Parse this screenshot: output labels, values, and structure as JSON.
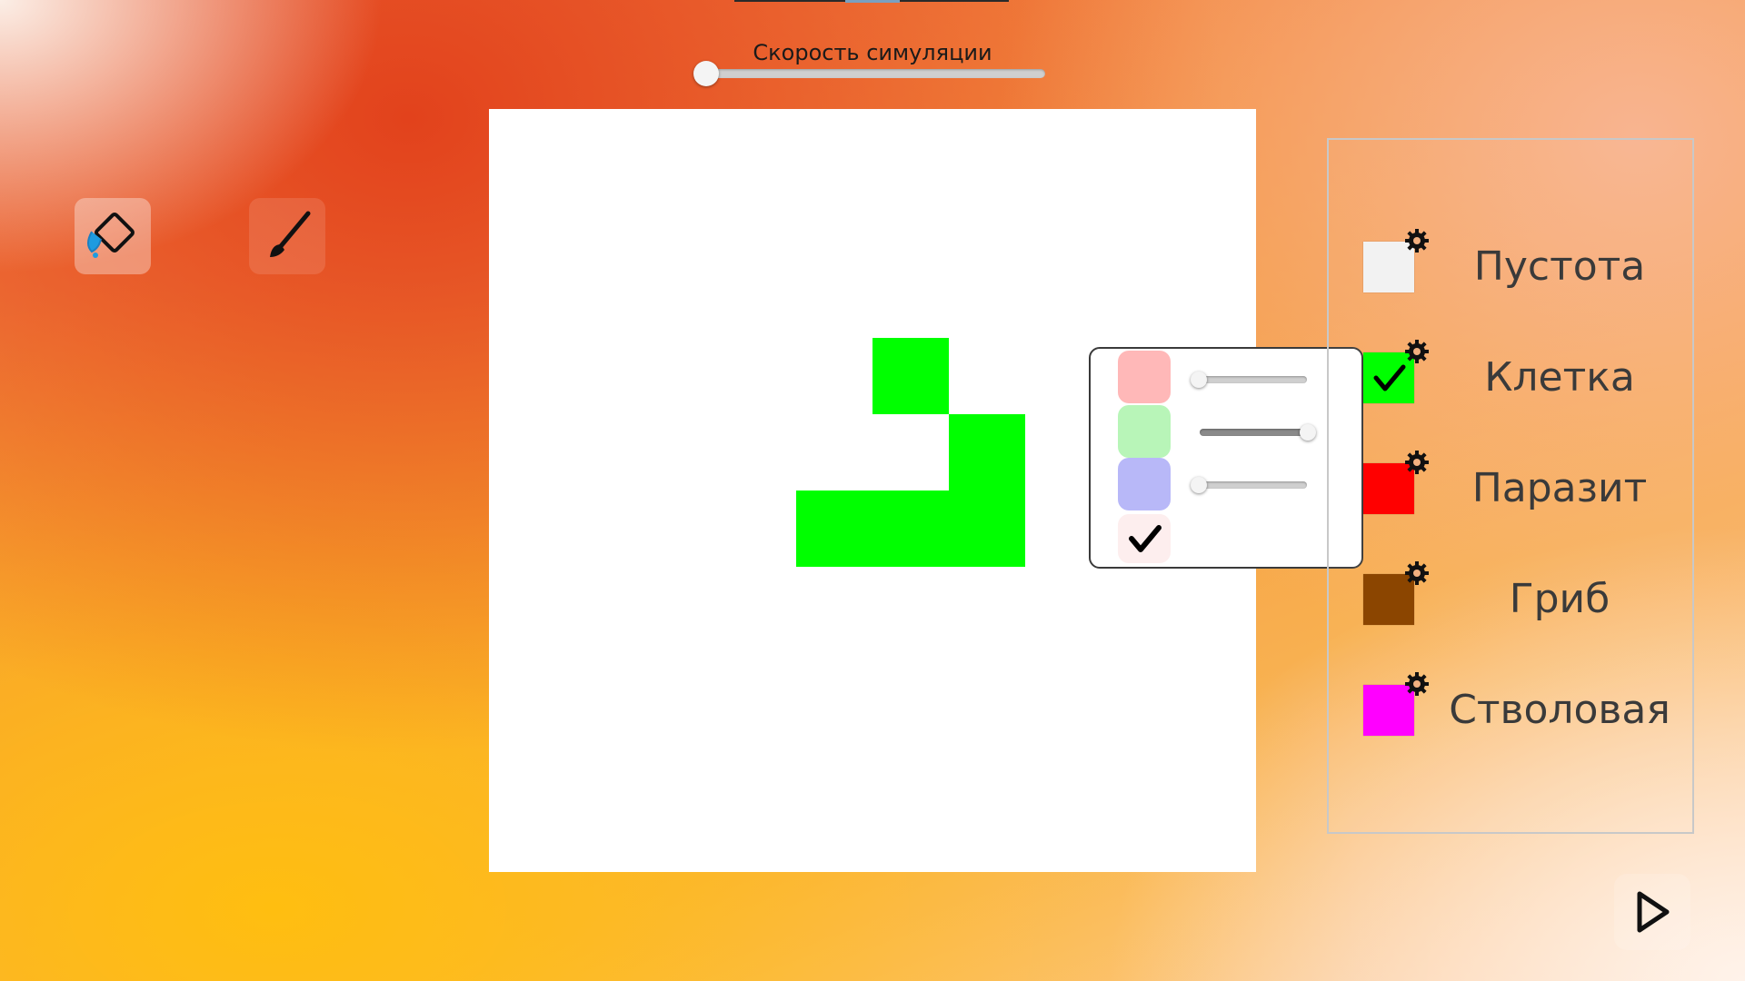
{
  "speed": {
    "label": "Скорость симуляции",
    "value": 0
  },
  "tools": [
    {
      "name": "fill-bucket",
      "active": true
    },
    {
      "name": "brush",
      "active": false
    }
  ],
  "grid": {
    "cell_color": "#00ff00",
    "background": "#ffffff"
  },
  "color_editor": {
    "channels": [
      {
        "channel": "red",
        "swatch_color": "#ffb8b8",
        "value": 0
      },
      {
        "channel": "green",
        "swatch_color": "#b8f5b8",
        "value": 1
      },
      {
        "channel": "blue",
        "swatch_color": "#b8b8f8",
        "value": 0
      }
    ],
    "confirm_icon": "check-icon"
  },
  "cell_types": [
    {
      "label": "Пустота",
      "color": "#f2f2f2",
      "selected": false
    },
    {
      "label": "Клетка",
      "color": "#00ff00",
      "selected": true
    },
    {
      "label": "Паразит",
      "color": "#ff0000",
      "selected": false
    },
    {
      "label": "Гриб",
      "color": "#8b4500",
      "selected": false
    },
    {
      "label": "Стволовая",
      "color": "#ff00ff",
      "selected": false
    }
  ],
  "play_icon": "play-icon"
}
